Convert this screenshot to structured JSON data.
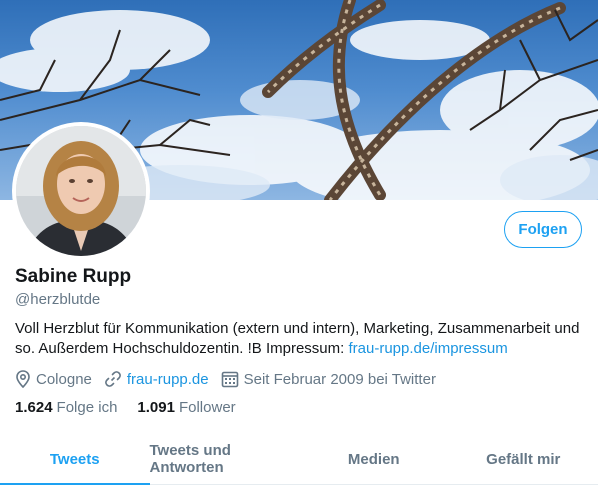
{
  "profile": {
    "name": "Sabine Rupp",
    "handle": "@herzblutde",
    "follow_label": "Folgen",
    "bio_text": "Voll Herzblut für Kommunikation (extern und intern), Marketing, Zusammenarbeit und so. Außerdem Hochschuldozentin. !B Impressum: ",
    "bio_link": "frau-rupp.de/impressum",
    "location": "Cologne",
    "website": "frau-rupp.de",
    "joined": "Seit Februar 2009 bei Twitter"
  },
  "stats": {
    "following_count": "1.624",
    "following_label": "Folge ich",
    "followers_count": "1.091",
    "followers_label": "Follower"
  },
  "tabs": [
    {
      "label": "Tweets",
      "active": true
    },
    {
      "label": "Tweets und Antworten",
      "active": false
    },
    {
      "label": "Medien",
      "active": false
    },
    {
      "label": "Gefällt mir",
      "active": false
    }
  ],
  "colors": {
    "accent": "#1da1f2",
    "link": "#1b95e0",
    "secondary_text": "#657786",
    "sky": "#4f8ccf"
  }
}
